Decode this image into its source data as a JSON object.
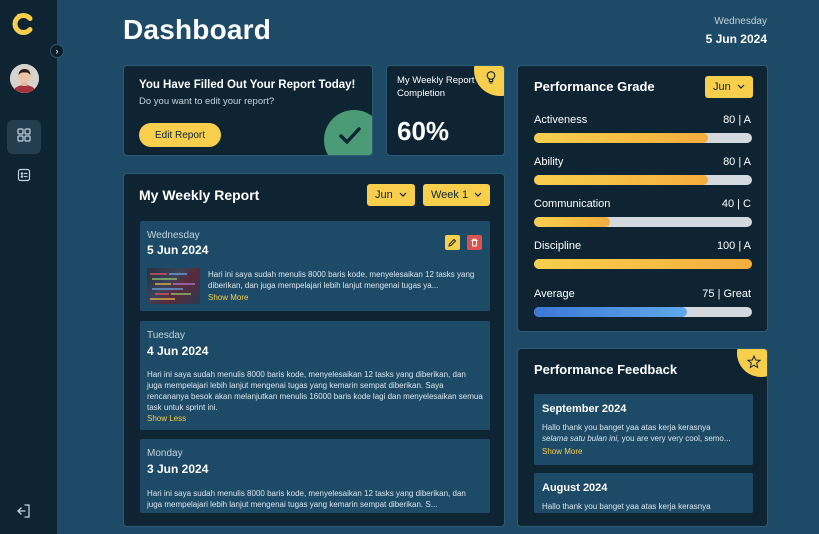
{
  "app": {
    "logo_icon": "c-logo-icon",
    "colors": {
      "background": "#1d4a66",
      "panel": "#0e2433",
      "accent": "#f7cf4d",
      "danger": "#d9534f",
      "success": "#4a9b76",
      "progress_average": "#3c78d8"
    }
  },
  "sidebar": {
    "items": [
      {
        "icon": "grid-icon",
        "active": true
      },
      {
        "icon": "report-icon",
        "active": false
      }
    ],
    "logout_icon": "logout-icon"
  },
  "header": {
    "title": "Dashboard",
    "day": "Wednesday",
    "date": "5 Jun 2024"
  },
  "filled_card": {
    "title": "You Have Filled Out Your Report Today!",
    "subtitle": "Do you want to edit your report?",
    "button_label": "Edit Report"
  },
  "completion_card": {
    "label": "My Weekly Report Completion",
    "value": "60%"
  },
  "weekly_report": {
    "title": "My Weekly Report",
    "month_select": "Jun",
    "week_select": "Week 1",
    "entries": [
      {
        "day": "Wednesday",
        "date": "5 Jun 2024",
        "text": "Hari ini saya sudah menulis 8000 baris kode, menyelesaikan 12 tasks yang diberikan, dan juga mempelajari lebih lanjut mengenai tugas ya...",
        "link": "Show More"
      },
      {
        "day": "Tuesday",
        "date": "4 Jun 2024",
        "text": "Hari ini saya sudah menulis 8000 baris kode, menyelesaikan 12 tasks yang diberikan, dan juga mempelajari lebih lanjut mengenai tugas yang kemarin sempat diberikan. Saya rencananya besok akan melanjutkan menulis 16000 baris kode lagi dan menyelesaikan semua task untuk sprint ini.",
        "link": "Show Less"
      },
      {
        "day": "Monday",
        "date": "3 Jun 2024",
        "text": "Hari ini saya sudah menulis 8000 baris kode, menyelesaikan 12 tasks yang diberikan, dan juga mempelajari lebih lanjut mengenai tugas yang kemarin sempat diberikan. S..."
      }
    ]
  },
  "performance_grade": {
    "title": "Performance Grade",
    "month_select": "Jun",
    "metrics": [
      {
        "name": "Activeness",
        "score": "80 | A",
        "percent": 0.8
      },
      {
        "name": "Ability",
        "score": "80 | A",
        "percent": 0.8
      },
      {
        "name": "Communication",
        "score": "40 | C",
        "percent": 0.35
      },
      {
        "name": "Discipline",
        "score": "100 | A",
        "percent": 1.0
      }
    ],
    "average": {
      "name": "Average",
      "score": "75 | Great",
      "percent": 0.7
    }
  },
  "performance_feedback": {
    "title": "Performance Feedback",
    "items": [
      {
        "month": "September 2024",
        "line1": "Hallo thank you banget yaa atas kerja kerasnya",
        "line2_italic": "selama satu bulan ini,",
        "line2_rest": " you are very very cool, semo...",
        "link": "Show More"
      },
      {
        "month": "August 2024",
        "line1": "Hallo thank you banget yaa atas kerja kerasnya"
      }
    ]
  }
}
